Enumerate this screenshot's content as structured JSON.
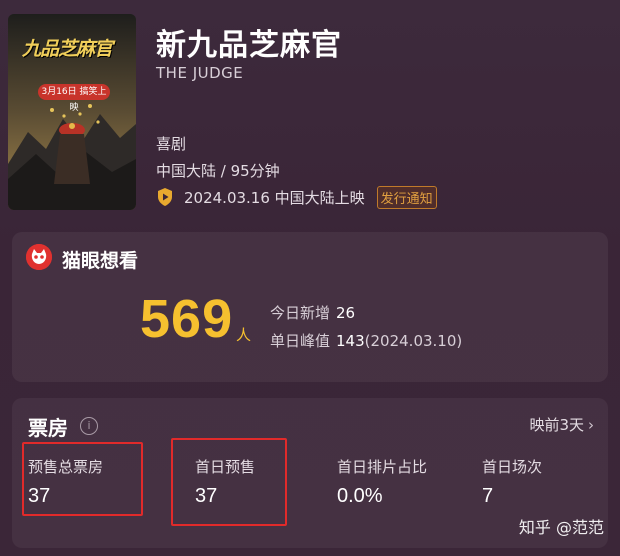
{
  "movie": {
    "title": "新九品芝麻官",
    "title_en": "THE JUDGE",
    "genre": "喜剧",
    "region_duration": "中国大陆 / 95分钟",
    "release": "2024.03.16 中国大陆上映",
    "notice_badge": "发行通知"
  },
  "poster": {
    "title": "九品芝麻官",
    "release_tag": "3月16日 搞笑上映"
  },
  "maoyan": {
    "title": "猫眼想看",
    "want_count": "569",
    "want_unit": "人",
    "today_label": "今日新增",
    "today_value": "26",
    "peak_label": "单日峰值",
    "peak_value": "143",
    "peak_date": "(2024.03.10)"
  },
  "boxoffice": {
    "title": "票房",
    "info_icon": "i",
    "prerelease": "映前3天",
    "chevron": "›",
    "metrics": [
      {
        "label": "预售总票房",
        "value": "37"
      },
      {
        "label": "首日预售",
        "value": "37"
      },
      {
        "label": "首日排片占比",
        "value": "0.0%"
      },
      {
        "label": "首日场次",
        "value": "7"
      }
    ]
  },
  "watermark": "知乎 @范范",
  "colors": {
    "accent_yellow": "#f6c02f",
    "maoyan_red": "#e0312f",
    "highlight_red": "#e12a2a",
    "notice_orange": "#e2a040"
  }
}
